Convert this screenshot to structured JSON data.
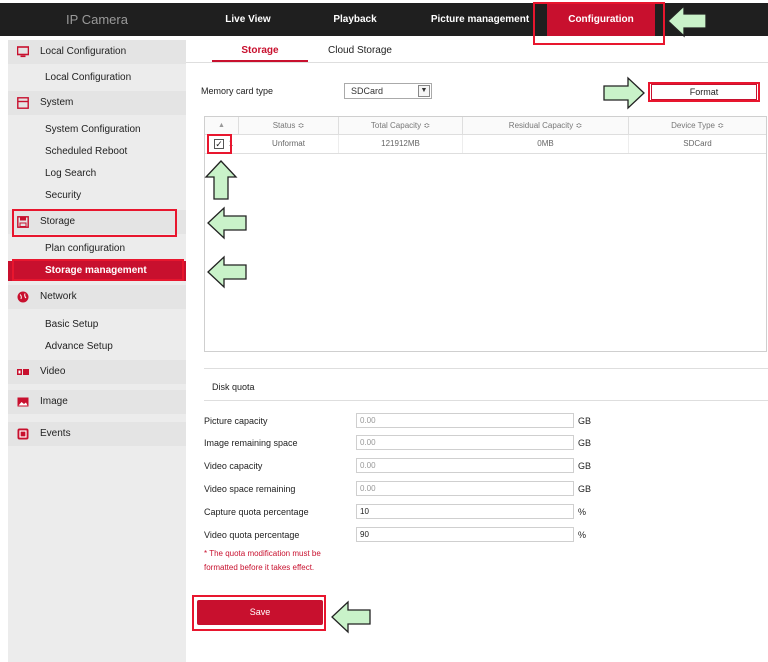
{
  "brand": "IP Camera",
  "nav": [
    "Live View",
    "Playback",
    "Picture management",
    "Configuration"
  ],
  "sidebar": {
    "local": {
      "label": "Local Configuration",
      "items": [
        "Local Configuration"
      ]
    },
    "system": {
      "label": "System",
      "items": [
        "System Configuration",
        "Scheduled Reboot",
        "Log Search",
        "Security"
      ]
    },
    "storage": {
      "label": "Storage",
      "items": [
        "Plan configuration",
        "Storage management"
      ]
    },
    "network": {
      "label": "Network",
      "items": [
        "Basic Setup",
        "Advance Setup"
      ]
    },
    "video": {
      "label": "Video"
    },
    "image": {
      "label": "Image"
    },
    "events": {
      "label": "Events"
    }
  },
  "tabs": [
    "Storage",
    "Cloud Storage"
  ],
  "memory": {
    "label": "Memory card type",
    "value": "SDCard",
    "format_label": "Format"
  },
  "table": {
    "headers": [
      "Status ≎",
      "Total Capacity ≎",
      "Residual Capacity ≎",
      "Device Type ≎"
    ],
    "sort_glyph": "▲",
    "row": {
      "index": "1",
      "status": "Unformat",
      "total": "121912MB",
      "residual": "0MB",
      "device": "SDCard"
    }
  },
  "quota": {
    "title": "Disk quota",
    "fields": [
      {
        "label": "Picture capacity",
        "value": "0.00",
        "unit": "GB"
      },
      {
        "label": "Image remaining space",
        "value": "0.00",
        "unit": "GB"
      },
      {
        "label": "Video capacity",
        "value": "0.00",
        "unit": "GB"
      },
      {
        "label": "Video space remaining",
        "value": "0.00",
        "unit": "GB"
      },
      {
        "label": "Capture quota percentage",
        "value": "10",
        "unit": "%"
      },
      {
        "label": "Video quota percentage",
        "value": "90",
        "unit": "%"
      }
    ],
    "note1": "* The quota modification must be",
    "note2": "formatted before it takes effect."
  },
  "save_label": "Save",
  "colors": {
    "accent": "#c8102e",
    "topbar": "#1f1f1f",
    "sidebar": "#ececec",
    "arrow_fill": "#c9f2c9"
  }
}
